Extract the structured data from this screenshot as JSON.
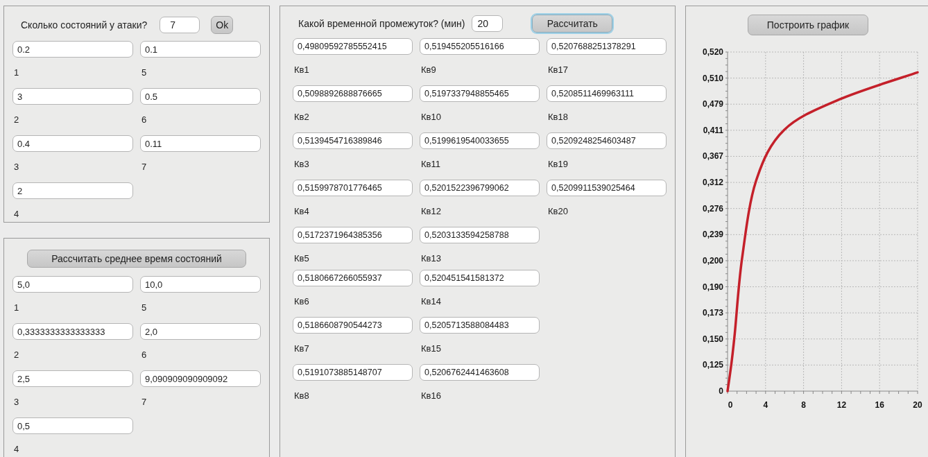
{
  "attack_panel": {
    "question": "Сколько состояний у атаки?",
    "count": "7",
    "ok_button": "Ok",
    "states": [
      {
        "value": "0.2",
        "label": "1"
      },
      {
        "value": "3",
        "label": "2"
      },
      {
        "value": "0.4",
        "label": "3"
      },
      {
        "value": "2",
        "label": "4"
      },
      {
        "value": "0.1",
        "label": "5"
      },
      {
        "value": "0.5",
        "label": "6"
      },
      {
        "value": "0.11",
        "label": "7"
      }
    ]
  },
  "mean_time_panel": {
    "button": "Рассчитать среднее время состояний",
    "states": [
      {
        "value": "5,0",
        "label": "1"
      },
      {
        "value": "0,3333333333333333",
        "label": "2"
      },
      {
        "value": "2,5",
        "label": "3"
      },
      {
        "value": "0,5",
        "label": "4"
      },
      {
        "value": "10,0",
        "label": "5"
      },
      {
        "value": "2,0",
        "label": "6"
      },
      {
        "value": "9,090909090909092",
        "label": "7"
      }
    ]
  },
  "interval_panel": {
    "question": "Какой временной промежуток? (мин)",
    "minutes": "20",
    "button": {
      "label": "Рассчитать",
      "focused": true
    },
    "results": [
      {
        "value": "0,49809592785552415",
        "label": "Кв1"
      },
      {
        "value": "0,5098892688876665",
        "label": "Кв2"
      },
      {
        "value": "0,5139454716389846",
        "label": "Кв3"
      },
      {
        "value": "0,5159978701776465",
        "label": "Кв4"
      },
      {
        "value": "0,5172371964385356",
        "label": "Кв5"
      },
      {
        "value": "0,5180667266055937",
        "label": "Кв6"
      },
      {
        "value": "0,5186608790544273",
        "label": "Кв7"
      },
      {
        "value": "0,5191073885148707",
        "label": "Кв8"
      },
      {
        "value": "0,519455205516166",
        "label": "Кв9"
      },
      {
        "value": "0,5197337948855465",
        "label": "Кв10"
      },
      {
        "value": "0,5199619540033655",
        "label": "Кв11"
      },
      {
        "value": "0,5201522396799062",
        "label": "Кв12"
      },
      {
        "value": "0,5203133594258788",
        "label": "Кв13"
      },
      {
        "value": "0,520451541581372",
        "label": "Кв14"
      },
      {
        "value": "0,5205713588084483",
        "label": "Кв15"
      },
      {
        "value": "0,5206762441463608",
        "label": "Кв16"
      },
      {
        "value": "0,5207688251378291",
        "label": "Кв17"
      },
      {
        "value": "0,5208511469963111",
        "label": "Кв18"
      },
      {
        "value": "0,5209248254603487",
        "label": "Кв19"
      },
      {
        "value": "0,5209911539025464",
        "label": "Кв20"
      }
    ]
  },
  "chart_panel": {
    "button": "Построить график",
    "y_tick_labels": [
      "0,520",
      "0,510",
      "0,479",
      "0,411",
      "0,367",
      "0,312",
      "0,276",
      "0,239",
      "0,200",
      "0,190",
      "0,173",
      "0,150",
      "0,125",
      "0"
    ],
    "x_tick_labels": [
      "0",
      "4",
      "8",
      "12",
      "16",
      "20"
    ]
  }
}
